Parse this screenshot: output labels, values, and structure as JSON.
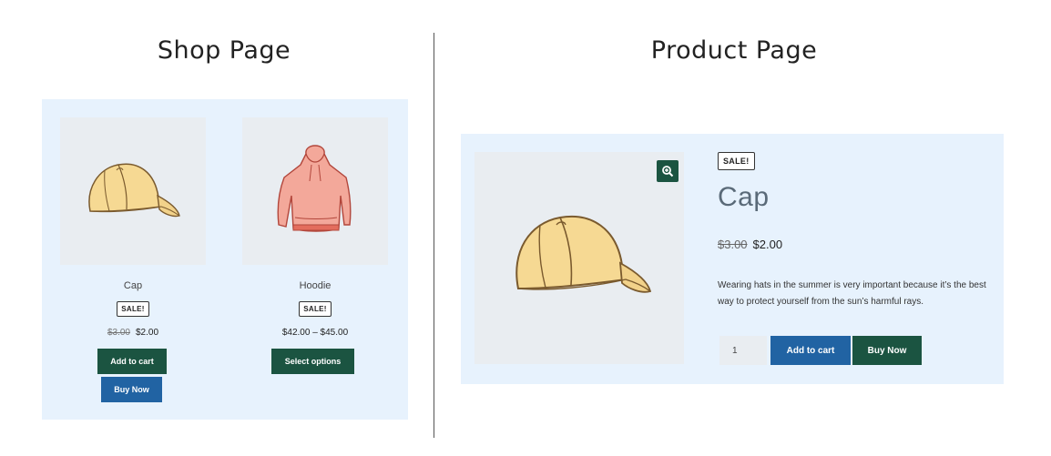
{
  "headings": {
    "shop": "Shop Page",
    "product": "Product Page"
  },
  "shop": {
    "products": [
      {
        "name": "Cap",
        "badge": "SALE!",
        "old_price": "$3.00",
        "price": "$2.00",
        "buttons": {
          "add_to_cart": "Add to cart",
          "buy_now": "Buy Now"
        }
      },
      {
        "name": "Hoodie",
        "badge": "SALE!",
        "price_range": "$42.00 – $45.00",
        "buttons": {
          "select_options": "Select options"
        }
      }
    ]
  },
  "product_page": {
    "badge": "SALE!",
    "name": "Cap",
    "old_price": "$3.00",
    "price": "$2.00",
    "description": "Wearing hats in the summer is very important because it’s the best way to protect yourself from the sun’s harmful rays.",
    "quantity": "1",
    "buttons": {
      "add_to_cart": "Add to cart",
      "buy_now": "Buy Now"
    },
    "zoom_icon": "zoom-in-icon"
  },
  "colors": {
    "panel_bg": "#e7f2fd",
    "primary_green": "#1b5441",
    "primary_blue": "#2163a3"
  }
}
